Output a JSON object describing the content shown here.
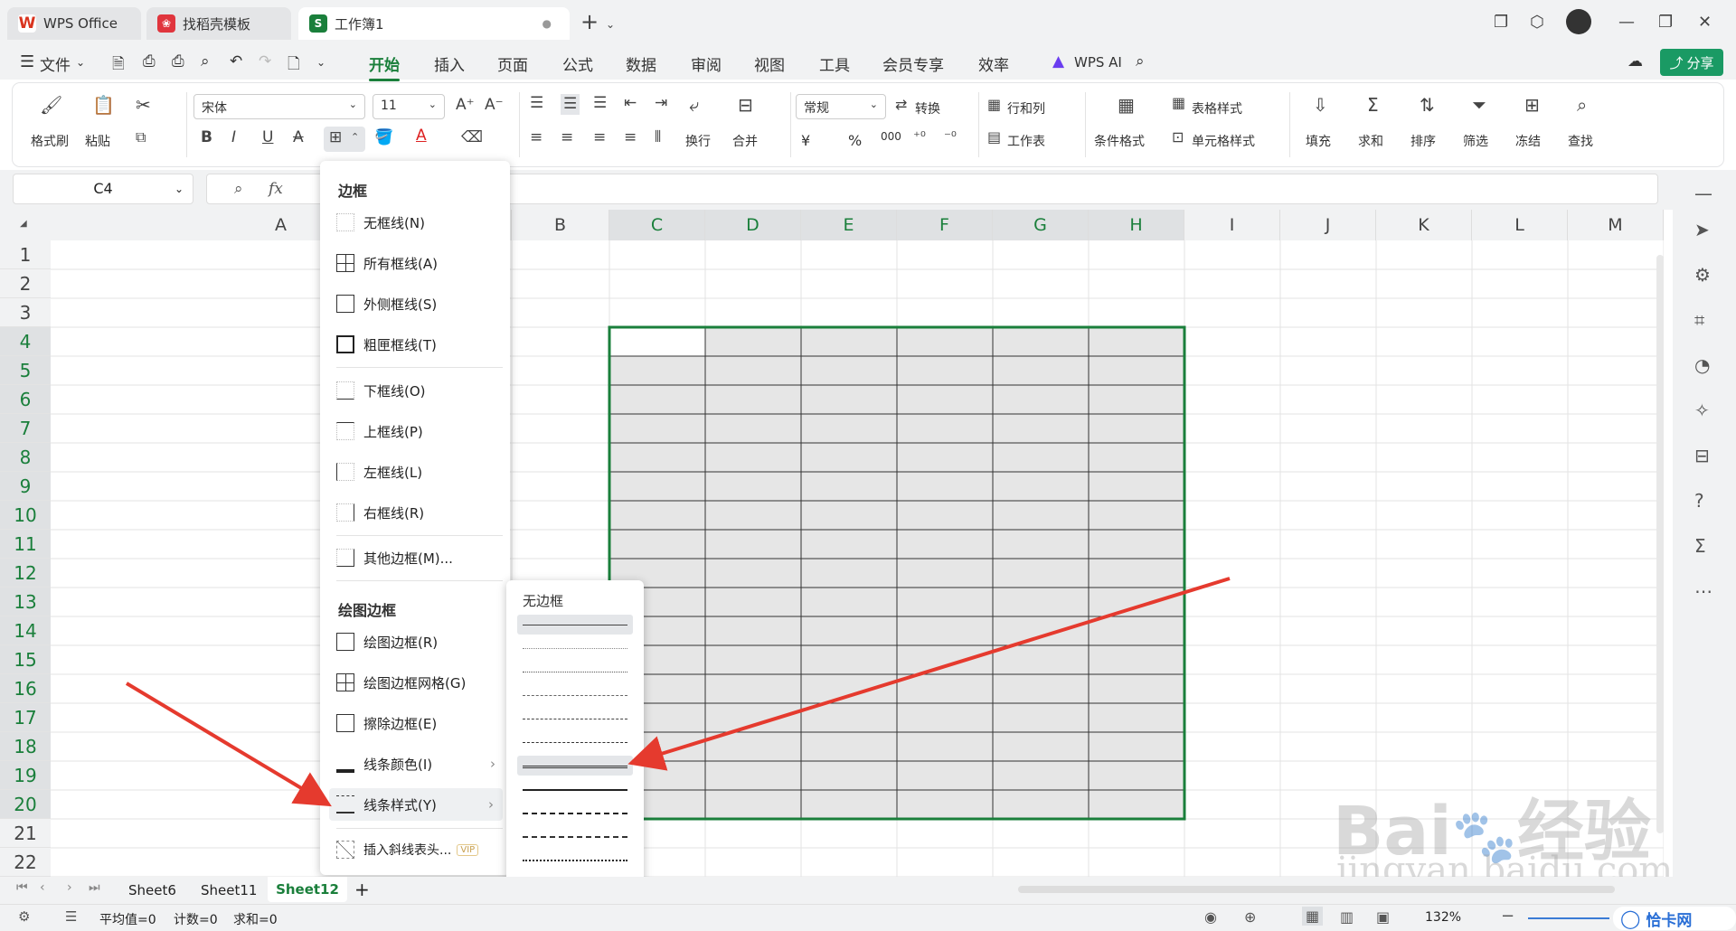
{
  "tabs": [
    {
      "label": "WPS Office",
      "icon": "wps-logo-icon",
      "color": "#d9341f"
    },
    {
      "label": "找稻壳模板",
      "icon": "docer-icon",
      "color": "#e0353d"
    },
    {
      "label": "工作簿1",
      "icon": "spreadsheet-icon",
      "color": "#1a7f3b"
    }
  ],
  "menu": {
    "file": "文件",
    "items": [
      "开始",
      "插入",
      "页面",
      "公式",
      "数据",
      "审阅",
      "视图",
      "工具",
      "会员专享",
      "效率"
    ],
    "wps_ai": "WPS AI",
    "share": "分享"
  },
  "ribbon": {
    "format_painter": "格式刷",
    "paste": "粘贴",
    "font_name": "宋体",
    "font_size": "11",
    "wrap": "换行",
    "merge": "合并",
    "number_format": "常规",
    "convert": "转换",
    "row_col": "行和列",
    "sheet": "工作表",
    "cond_format": "条件格式",
    "table_style": "表格样式",
    "cell_style": "单元格样式",
    "fill": "填充",
    "sum": "求和",
    "sort": "排序",
    "filter": "筛选",
    "freeze": "冻结",
    "find": "查找",
    "currency": "¥",
    "percent": "%",
    "thousands": "000"
  },
  "formula": {
    "cell_ref": "C4",
    "fx": "fx"
  },
  "columns": [
    "A",
    "B",
    "C",
    "D",
    "E",
    "F",
    "G",
    "H",
    "I",
    "J",
    "K",
    "L",
    "M"
  ],
  "rows": [
    "1",
    "2",
    "3",
    "4",
    "5",
    "6",
    "7",
    "8",
    "9",
    "10",
    "11",
    "12",
    "13",
    "14",
    "15",
    "16",
    "17",
    "18",
    "19",
    "20",
    "21",
    "22"
  ],
  "border_menu": {
    "section1": "边框",
    "items1": [
      "无框线(N)",
      "所有框线(A)",
      "外侧框线(S)",
      "粗匣框线(T)"
    ],
    "items2": [
      "下框线(O)",
      "上框线(P)",
      "左框线(L)",
      "右框线(R)"
    ],
    "other": "其他边框(M)...",
    "section2": "绘图边框",
    "items3": [
      "绘图边框(R)",
      "绘图边框网格(G)",
      "擦除边框(E)",
      "线条颜色(I)",
      "线条样式(Y)"
    ],
    "diag": "插入斜线表头...",
    "vip": "VIP"
  },
  "line_style_menu": {
    "none": "无边框"
  },
  "sheets": [
    "Sheet6",
    "Sheet11",
    "Sheet12"
  ],
  "active_sheet": "Sheet12",
  "status": {
    "avg": "平均值=0",
    "count": "计数=0",
    "sum": "求和=0",
    "zoom": "132%"
  },
  "watermark": {
    "site": "jingyan.baidu.com",
    "brand": "Bai",
    "brand2": "经验",
    "corner": "恰卡网"
  },
  "colors": {
    "accent": "#1a7f3b",
    "arrow": "#e53a2e",
    "selection_fill": "#e6e6e6"
  }
}
